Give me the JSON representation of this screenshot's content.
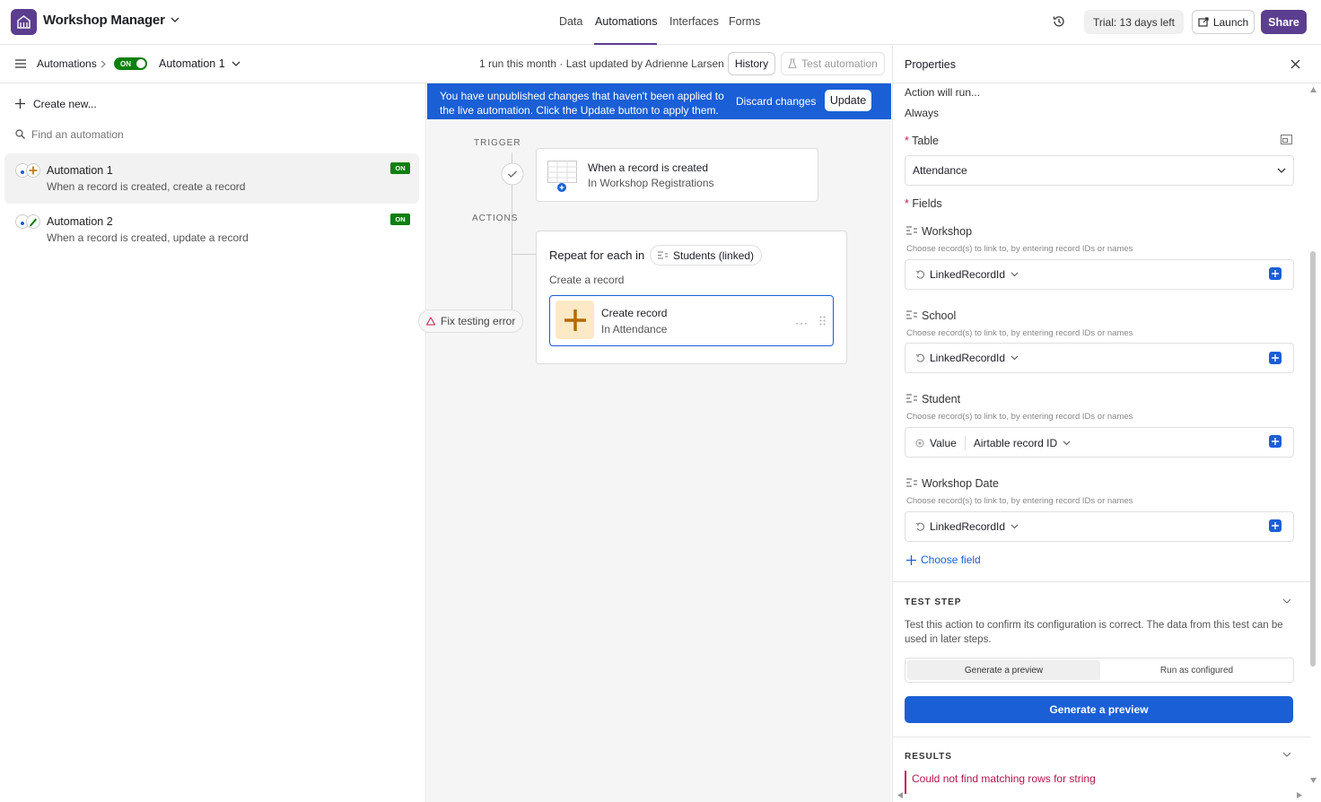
{
  "app": {
    "title": "Workshop Manager"
  },
  "nav": {
    "tabs": [
      "Data",
      "Automations",
      "Interfaces",
      "Forms"
    ],
    "active": "Automations"
  },
  "topright": {
    "trial": "Trial: 13 days left",
    "launch": "Launch",
    "share": "Share"
  },
  "subbar": {
    "breadcrumb": "Automations",
    "toggle": "ON",
    "current": "Automation 1",
    "run_info": "1 run this month · Last updated by Adrienne Larsen",
    "history": "History",
    "test": "Test automation"
  },
  "sidebar": {
    "create": "Create new...",
    "search_placeholder": "Find an automation",
    "items": [
      {
        "name": "Automation 1",
        "desc": "When a record is created, create a record",
        "badge": "ON"
      },
      {
        "name": "Automation 2",
        "desc": "When a record is created, update a record",
        "badge": "ON"
      }
    ]
  },
  "canvas": {
    "banner_line1": "You have unpublished changes that haven't been applied to",
    "banner_line2": "the live automation. Click the Update button to apply them.",
    "discard": "Discard changes",
    "update": "Update",
    "trigger_label": "TRIGGER",
    "trigger_title": "When a record is created",
    "trigger_sub": "In Workshop Registrations",
    "actions_label": "ACTIONS",
    "repeat_title": "Repeat for each in",
    "repeat_chip": "Students (linked)",
    "repeat_sub": "Create a record",
    "action_title": "Create record",
    "action_sub": "In Attendance",
    "fix_error": "Fix testing error"
  },
  "properties": {
    "title": "Properties",
    "action_run_label": "Action will run...",
    "action_run_value": "Always",
    "table_label": "Table",
    "table_value": "Attendance",
    "fields_label": "Fields",
    "hint": "Choose record(s) to link to, by entering record IDs or names",
    "fields": [
      {
        "name": "Workshop",
        "token": "LinkedRecordId"
      },
      {
        "name": "School",
        "token": "LinkedRecordId"
      },
      {
        "name": "Student",
        "token_a": "Value",
        "token_b": "Airtable record ID"
      },
      {
        "name": "Workshop Date",
        "token": "LinkedRecordId"
      }
    ],
    "choose_field": "Choose field",
    "test_step_label": "TEST STEP",
    "test_step_desc1": "Test this action to confirm its configuration is correct. The data from this test can be",
    "test_step_desc2": "used in later steps.",
    "seg_left": "Generate a preview",
    "seg_right": "Run as configured",
    "generate_btn": "Generate a preview",
    "results_label": "RESULTS",
    "results_error": "Could not find matching rows for string"
  },
  "colors": {
    "brand": "#5b3e8f",
    "primary": "#1a5fd6",
    "on": "#0d7f0d",
    "error": "#b3164a"
  }
}
